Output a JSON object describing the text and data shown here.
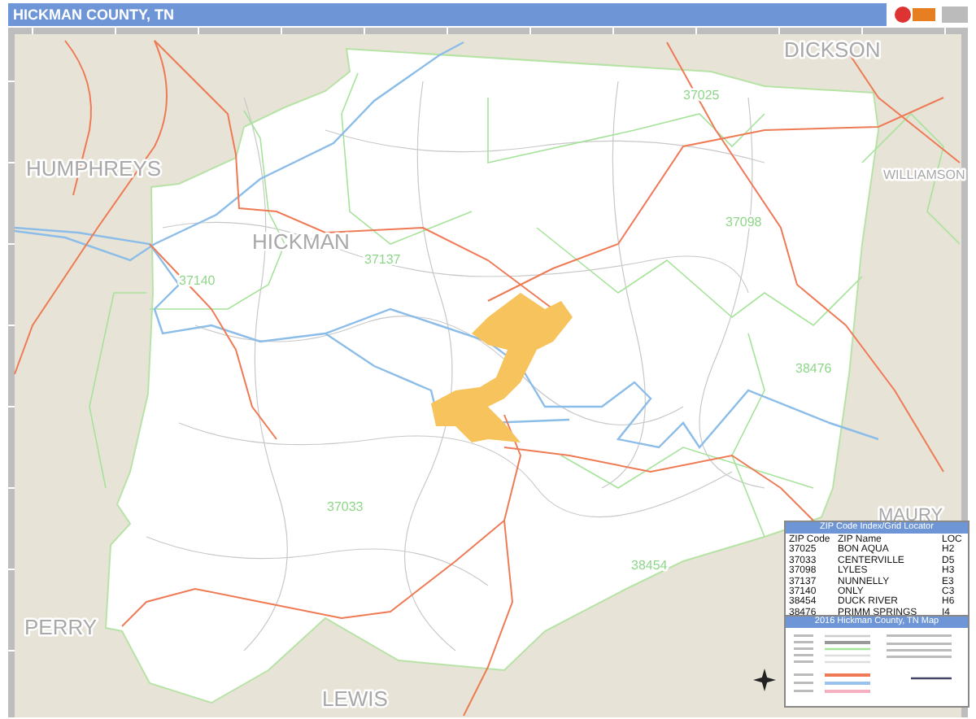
{
  "header": {
    "title": "HICKMAN COUNTY, TN"
  },
  "map": {
    "county_labels": [
      "HUMPHREYS",
      "HICKMAN",
      "DICKSON",
      "WILLIAMSON",
      "MAURY",
      "PERRY",
      "LEWIS"
    ],
    "zip_labels": [
      "37025",
      "37137",
      "37140",
      "37098",
      "38476",
      "37033",
      "38454"
    ]
  },
  "zip_index": {
    "title": "ZIP Code Index/Grid Locator",
    "columns": [
      "ZIP Code",
      "ZIP Name",
      "LOC"
    ],
    "rows": [
      [
        "37025",
        "BON AQUA",
        "H2"
      ],
      [
        "37033",
        "CENTERVILLE",
        "D5"
      ],
      [
        "37098",
        "LYLES",
        "H3"
      ],
      [
        "37137",
        "NUNNELLY",
        "E3"
      ],
      [
        "37140",
        "ONLY",
        "C3"
      ],
      [
        "38454",
        "DUCK RIVER",
        "H6"
      ],
      [
        "38476",
        "PRIMM SPRINGS",
        "I4"
      ]
    ]
  },
  "map_legend": {
    "title": "2016 Hickman County, TN Map"
  }
}
